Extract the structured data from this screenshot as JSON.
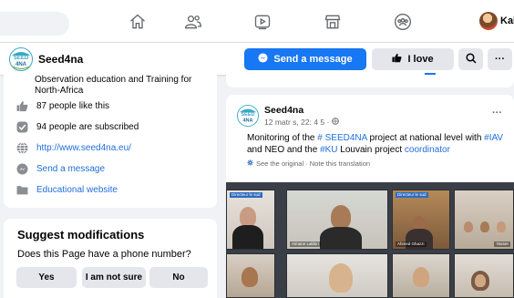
{
  "user": {
    "name": "Kah"
  },
  "page": {
    "name": "Seed4na",
    "logo_text": "SEED\n4NA",
    "brand_color": "#3aa9c8"
  },
  "actions": {
    "send_message": "Send a message",
    "like": "I love"
  },
  "about": {
    "description": "Observation education and Training for North-Africa",
    "rows": [
      {
        "icon": "thumbs-up-icon",
        "text": "87 people like this"
      },
      {
        "icon": "check-square-icon",
        "text": "94 people are subscribed"
      },
      {
        "icon": "globe-icon",
        "text": "http://www.seed4na.eu/"
      },
      {
        "icon": "messenger-icon",
        "text": "Send a message"
      },
      {
        "icon": "folder-icon",
        "text": "Educational website"
      }
    ]
  },
  "suggest": {
    "title": "Suggest modifications",
    "question": "Does this Page have a phone number?",
    "buttons": [
      "Yes",
      "I am not sure",
      "No"
    ]
  },
  "post": {
    "author": "Seed4na",
    "date": "12 matr s, 22: 4 5 ·",
    "text_parts": [
      "Monitoring of the ",
      "# SEED4NA",
      " project at national level with ",
      "#IAV",
      " and NEO and the ",
      "#KU",
      " Louvain project ",
      "coordinator"
    ],
    "translate": "See the original · Note this translation",
    "photo_labels": [
      "Directeur le sud",
      "Directeur le sud",
      "Aimane Lakbiri",
      "Ahmed Ghazzi",
      "Yasser"
    ]
  },
  "colors": {
    "accent": "#1877f2",
    "link": "#216fdb",
    "background": "#f0f2f5"
  }
}
